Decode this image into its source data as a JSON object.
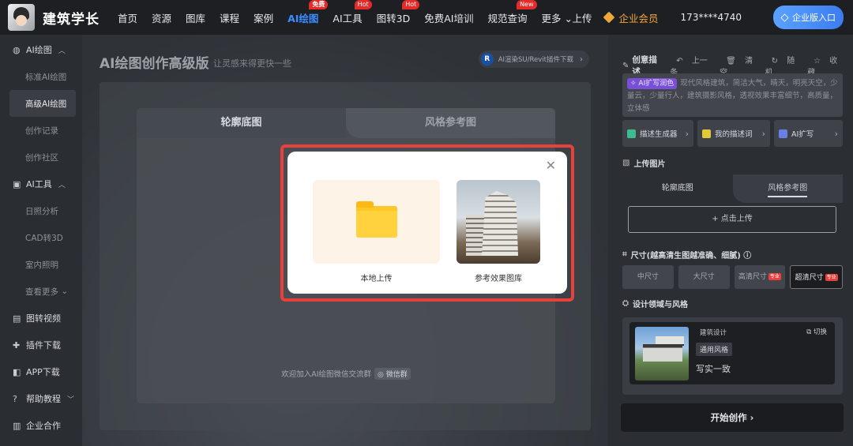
{
  "brand": {
    "name": "建筑学长"
  },
  "nav": {
    "items": [
      {
        "label": "首页",
        "badge": ""
      },
      {
        "label": "资源",
        "badge": ""
      },
      {
        "label": "图库",
        "badge": ""
      },
      {
        "label": "课程",
        "badge": ""
      },
      {
        "label": "案例",
        "badge": ""
      },
      {
        "label": "AI绘图",
        "badge": "免费",
        "active": true
      },
      {
        "label": "AI工具",
        "badge": "Hot"
      },
      {
        "label": "图转3D",
        "badge": "Hot"
      },
      {
        "label": "免费AI培训",
        "badge": ""
      },
      {
        "label": "规范查询",
        "badge": "New"
      },
      {
        "label": "更多",
        "badge": ""
      }
    ],
    "upload": "上传",
    "vip": "企业会员",
    "phone": "173****4740",
    "enterprise_entry": "企业版入口"
  },
  "sidebar": {
    "group_ai_drawing": "AI绘图",
    "standard": "标准AI绘图",
    "advanced": "高级AI绘图",
    "history": "创作记录",
    "community": "创作社区",
    "group_ai_tools": "AI工具",
    "sunlight": "日照分析",
    "cad3d": "CAD转3D",
    "lighting": "室内照明",
    "more": "查看更多",
    "video": "图转视频",
    "plugin": "插件下载",
    "app": "APP下载",
    "help": "帮助教程",
    "coop": "企业合作"
  },
  "main": {
    "title": "AI绘图创作高级版",
    "subtitle": "让灵感来得更快一些",
    "plugin_link": "AI渲染SU/Revit插件下载",
    "tab_outline": "轮廓底图",
    "tab_style": "风格参考图",
    "wechat_text": "欢迎加入AI绘图微信交流群",
    "wechat_tag": "微信群"
  },
  "modal": {
    "local_upload": "本地上传",
    "gallery": "参考效果图库",
    "highlight_color": "#e8413b"
  },
  "right": {
    "prompt_title": "创意描述",
    "prev": "上一条",
    "clear": "清空",
    "random": "随机",
    "favorite": "收藏",
    "ai_chip": "AI扩写润色",
    "prompt_text": "现代风格建筑，简洁大气，晴天，明亮天空，少量云，少量行人，建筑摄影风格，透视效果丰富细节，高质量，立体感",
    "tool_generator": "描述生成器",
    "tool_my": "我的描述词",
    "tool_ai": "AI扩写",
    "upload_title": "上传图片",
    "up_tab_outline": "轮廓底图",
    "up_tab_style": "风格参考图",
    "upload_btn": "+ 点击上传",
    "size_title": "尺寸(越高清生图越准确、细腻)",
    "sizes": [
      "中尺寸",
      "大尺寸",
      "高清尺寸",
      "超清尺寸"
    ],
    "size_tag": "专业",
    "domain_title": "设计领域与风格",
    "domain": "建筑设计",
    "switch": "切换",
    "style_tag": "通用风格",
    "style_name": "写实一致",
    "start": "开始创作 ›"
  }
}
